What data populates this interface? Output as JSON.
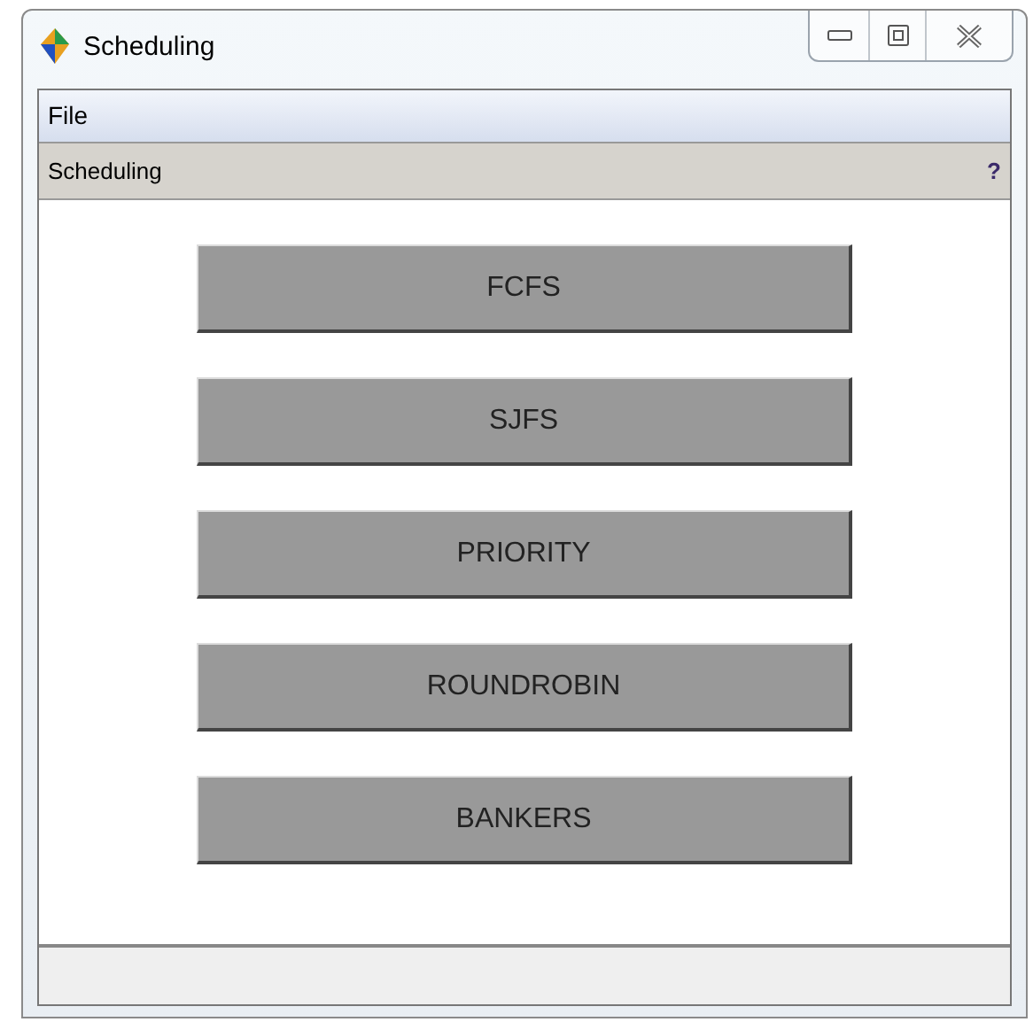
{
  "window": {
    "title": "Scheduling"
  },
  "menu": [
    "File"
  ],
  "panel": {
    "title": "Scheduling",
    "help": "?"
  },
  "buttons": [
    "FCFS",
    "SJFS",
    "PRIORITY",
    "ROUNDROBIN",
    "BANKERS"
  ]
}
